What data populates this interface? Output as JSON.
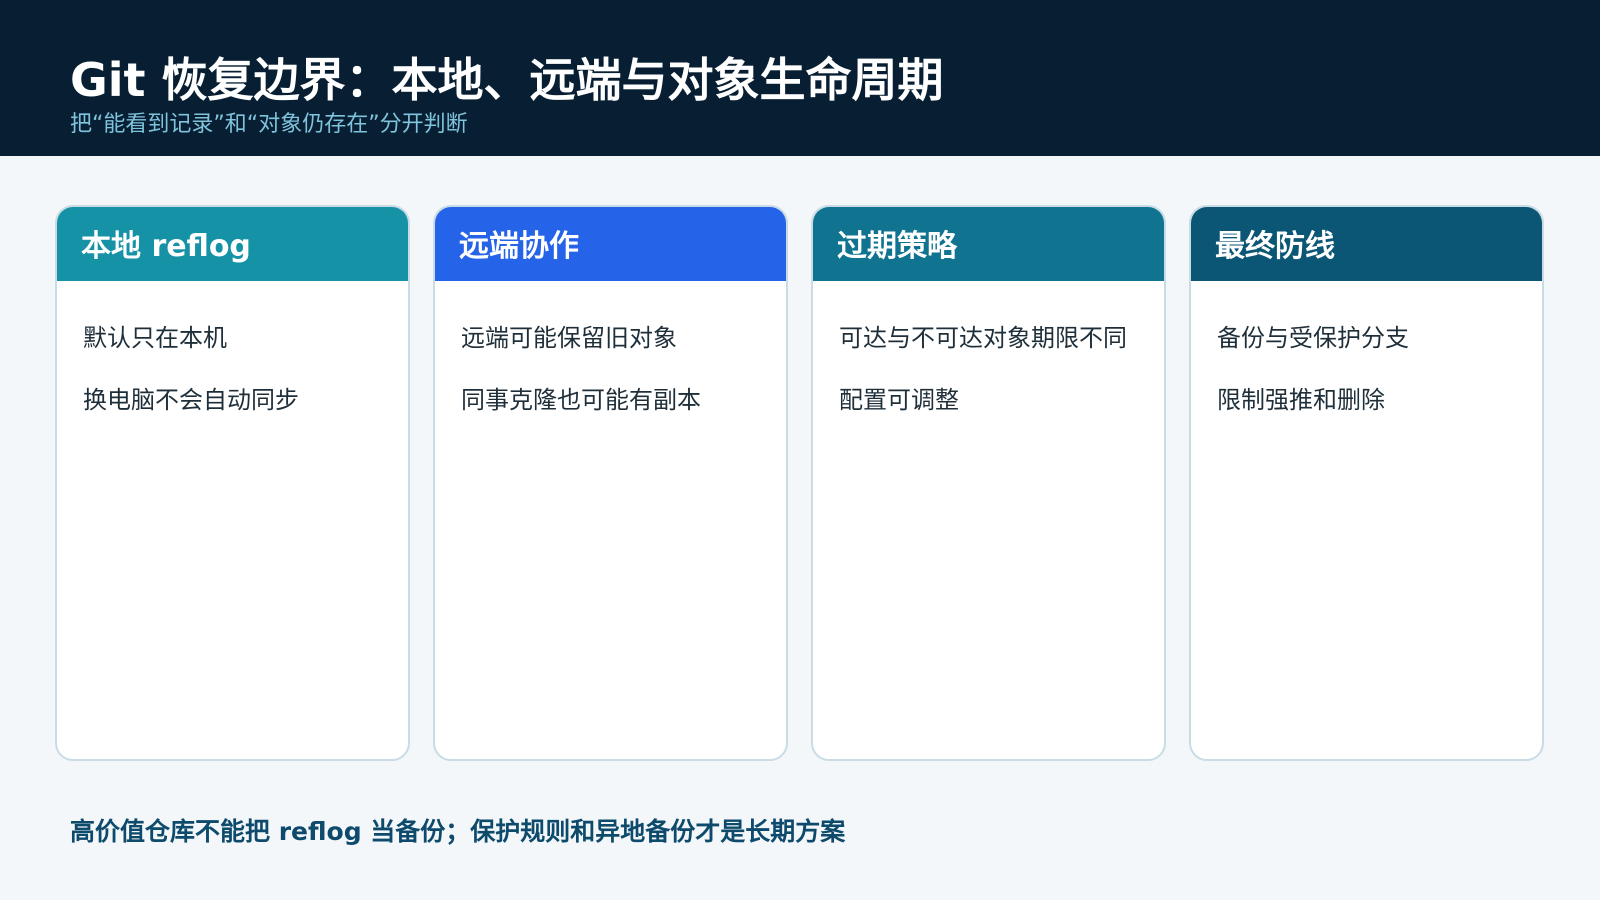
{
  "header": {
    "title": "Git 恢复边界：本地、远端与对象生命周期",
    "subtitle": "把“能看到记录”和“对象仍存在”分开判断"
  },
  "cards": [
    {
      "title": "本地 reflog",
      "color": "#1592a6",
      "items": [
        "默认只在本机",
        "换电脑不会自动同步"
      ]
    },
    {
      "title": "远端协作",
      "color": "#2563e8",
      "items": [
        "远端可能保留旧对象",
        "同事克隆也可能有副本"
      ]
    },
    {
      "title": "过期策略",
      "color": "#10738f",
      "items": [
        "可达与不可达对象期限不同",
        "配置可调整"
      ]
    },
    {
      "title": "最终防线",
      "color": "#0c5675",
      "items": [
        "备份与受保护分支",
        "限制强推和删除"
      ]
    }
  ],
  "footer": {
    "text": "高价值仓库不能把 reflog 当备份；保护规则和异地备份才是长期方案"
  },
  "colors": {
    "header_bg": "#081f33",
    "page_bg": "#f3f7fa",
    "subtitle": "#7fc3dc",
    "footer_text": "#0d4a6b",
    "card_border": "#c9dce6"
  }
}
